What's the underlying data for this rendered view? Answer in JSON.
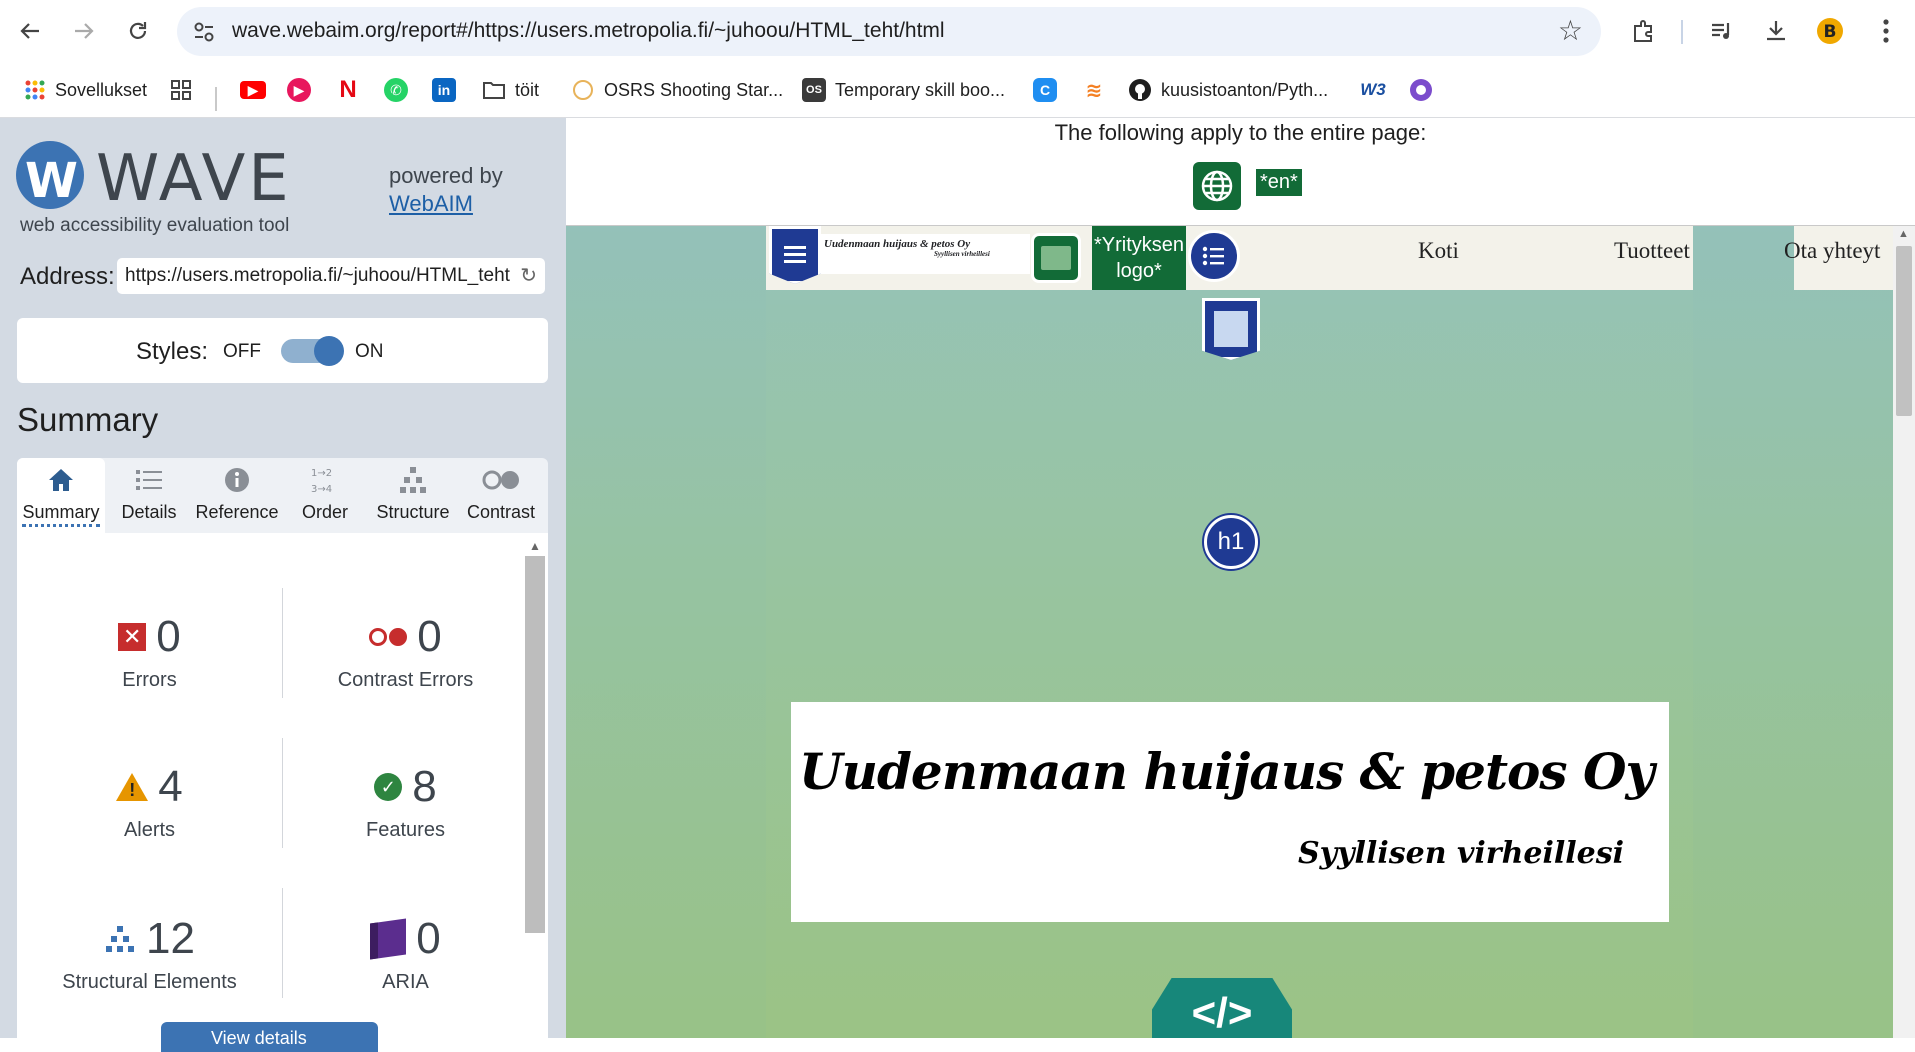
{
  "browser": {
    "url": "wave.webaim.org/report#/https://users.metropolia.fi/~juhoou/HTML_teht/html",
    "bookmarks": {
      "apps_label": "Sovellukset",
      "folder_label": "töit",
      "osrs_label": "OSRS Shooting Star...",
      "skill_label": "Temporary skill boo...",
      "github_label": "kuusistoanton/Pyth..."
    }
  },
  "wave": {
    "logo_text": "WAVE",
    "logo_subtitle": "web accessibility evaluation tool",
    "powered_by": "powered by",
    "webaim_link": "WebAIM",
    "address_label": "Address:",
    "address_value": "https://users.metropolia.fi/~juhoou/HTML_teht/html",
    "styles_label": "Styles:",
    "styles_off": "OFF",
    "styles_on": "ON",
    "styles_enabled": true,
    "summary_heading": "Summary",
    "tabs": [
      {
        "label": "Summary",
        "icon": "home-icon",
        "active": true
      },
      {
        "label": "Details",
        "icon": "list-icon",
        "active": false
      },
      {
        "label": "Reference",
        "icon": "info-icon",
        "active": false
      },
      {
        "label": "Order",
        "icon": "order-icon",
        "active": false
      },
      {
        "label": "Structure",
        "icon": "structure-icon",
        "active": false
      },
      {
        "label": "Contrast",
        "icon": "contrast-icon",
        "active": false
      }
    ],
    "stats": {
      "errors": {
        "value": "0",
        "label": "Errors"
      },
      "contrast_errors": {
        "value": "0",
        "label": "Contrast Errors"
      },
      "alerts": {
        "value": "4",
        "label": "Alerts"
      },
      "features": {
        "value": "8",
        "label": "Features"
      },
      "structural": {
        "value": "12",
        "label": "Structural Elements"
      },
      "aria": {
        "value": "0",
        "label": "ARIA"
      }
    },
    "view_details_label": "View details"
  },
  "preview": {
    "applies_text": "The following apply to the entire page:",
    "lang_badge": "*en*",
    "site": {
      "nav_links": [
        "Koti",
        "Tuotteet",
        "Ota yhteyt"
      ],
      "logo_alt_badge": "*Yrityksen logo*",
      "nav_logo_title": "Uudenmaan huijaus & petos Oy",
      "nav_logo_sub": "Syyllisen virheillesi",
      "hero_title": "Uudenmaan huijaus & petos Oy",
      "hero_subtitle": "Syyllisen virheillesi",
      "code_badge": "</>",
      "h1_badge": "h1"
    }
  },
  "colors": {
    "wave_blue": "#3c73b3",
    "panel_bg": "#d3dae3",
    "error_red": "#c62d2d",
    "alert_orange": "#e69500",
    "feature_green": "#2e8540",
    "aria_purple": "#5b2d8e",
    "badge_green": "#126b37",
    "structure_navy": "#1f3a93"
  }
}
